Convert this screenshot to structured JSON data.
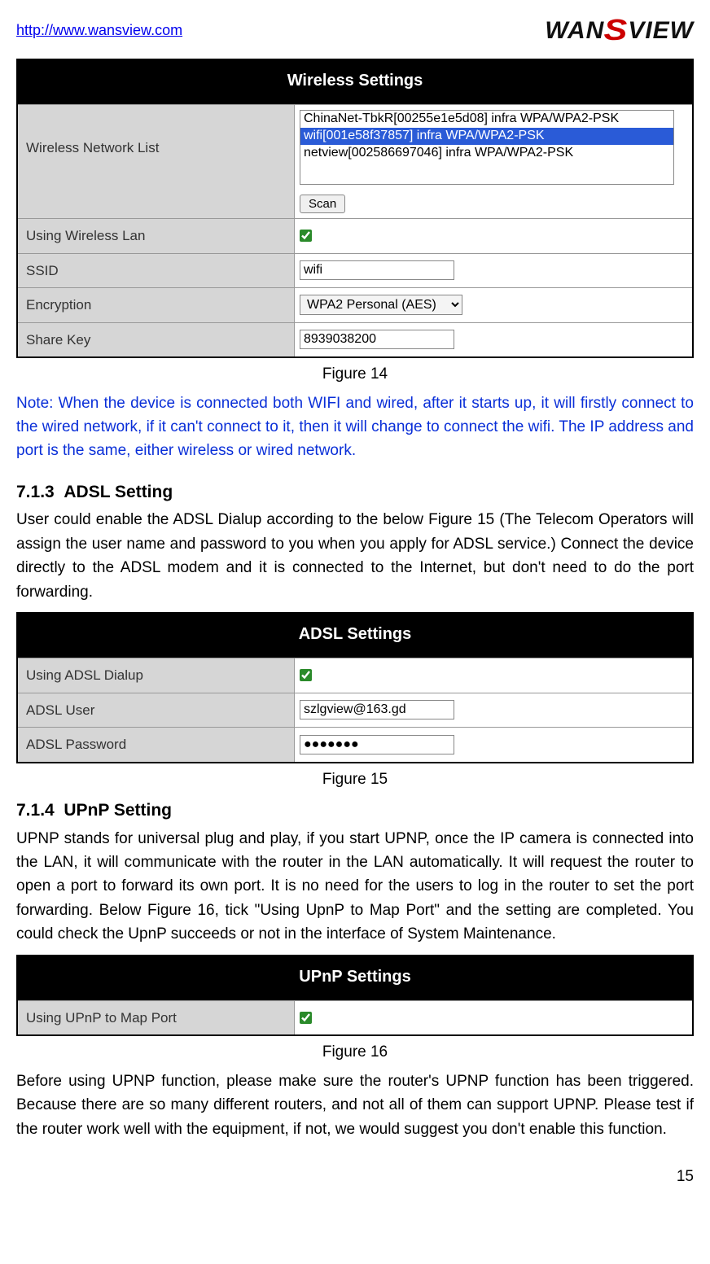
{
  "header": {
    "url": "http://www.wansview.com",
    "logo_wan": "WAN",
    "logo_s": "S",
    "logo_view": "VIEW"
  },
  "wireless": {
    "title": "Wireless Settings",
    "network_list_label": "Wireless Network List",
    "networks": [
      "ChinaNet-TbkR[00255e1e5d08] infra WPA/WPA2-PSK",
      "wifi[001e58f37857] infra WPA/WPA2-PSK",
      "netview[002586697046] infra WPA/WPA2-PSK"
    ],
    "selected_index": 1,
    "scan_button": "Scan",
    "using_label": "Using Wireless Lan",
    "ssid_label": "SSID",
    "ssid_value": "wifi",
    "encryption_label": "Encryption",
    "encryption_value": "WPA2 Personal (AES)",
    "sharekey_label": "Share Key",
    "sharekey_value": "8939038200"
  },
  "captions": {
    "fig14": "Figure 14",
    "fig15": "Figure 15",
    "fig16": "Figure 16"
  },
  "note_text": "Note: When the device is connected both WIFI and wired, after it starts up, it will firstly connect to the wired network, if it can't connect to it, then it will change to connect the wifi. The IP address and port is the same, either wireless or wired network.",
  "adsl": {
    "heading_number": "7.1.3",
    "heading_title": "ADSL Setting",
    "paragraph": "User could enable the ADSL Dialup according to the below Figure 15 (The Telecom Operators will assign the user name and password to you when you apply for ADSL service.) Connect the device directly to the ADSL modem and it is connected to the Internet, but don't need to do the port forwarding.",
    "title": "ADSL Settings",
    "using_label": "Using ADSL Dialup",
    "user_label": "ADSL User",
    "user_value": "szlgview@163.gd",
    "password_label": "ADSL Password",
    "password_value": "●●●●●●●"
  },
  "upnp": {
    "heading_number": "7.1.4",
    "heading_title": "UPnP Setting",
    "paragraph1": "UPNP stands for universal plug and play, if you start UPNP, once the IP camera is connected into the LAN, it will communicate with the router in the LAN automatically. It will request the router to open a port to forward its own port. It is no need for the users to log in the router to set the port forwarding. Below Figure 16, tick \"Using UpnP to Map Port\" and the setting are completed. You could check the UpnP succeeds or not in the interface of System Maintenance.",
    "title": "UPnP Settings",
    "using_label": "Using UPnP to Map Port",
    "paragraph2": "Before using UPNP function, please make sure the router's UPNP function has been triggered. Because there are so many different routers, and not all of them can support UPNP. Please test if the router work well with the equipment, if not, we would suggest you don't enable this function."
  },
  "page_number": "15"
}
